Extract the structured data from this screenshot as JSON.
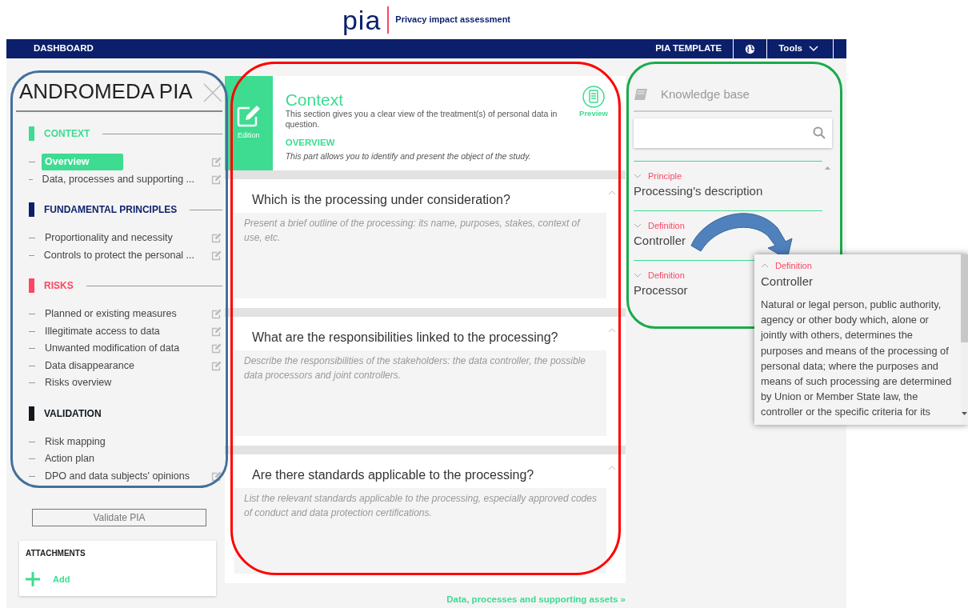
{
  "header": {
    "logo": "pia",
    "tagline": "Privacy impact assessment"
  },
  "navbar": {
    "left": "DASHBOARD",
    "template": "PIA TEMPLATE",
    "tools": "Tools"
  },
  "sidebar": {
    "title": "ANDROMEDA PIA",
    "sections": [
      {
        "title": "CONTEXT",
        "color": "#3ddc91",
        "items": [
          {
            "label": "Overview",
            "selected": true,
            "editable": true
          },
          {
            "label": "Data, processes and supporting ...",
            "selected": false,
            "editable": true
          }
        ]
      },
      {
        "title": "FUNDAMENTAL PRINCIPLES",
        "color": "#0b1f6b",
        "items": [
          {
            "label": "Proportionality and necessity",
            "selected": false,
            "editable": true
          },
          {
            "label": "Controls to protect the personal ...",
            "selected": false,
            "editable": true
          }
        ]
      },
      {
        "title": "RISKS",
        "color": "#fd4664",
        "items": [
          {
            "label": "Planned or existing measures",
            "selected": false,
            "editable": true
          },
          {
            "label": "Illegitimate access to data",
            "selected": false,
            "editable": true
          },
          {
            "label": "Unwanted modification of data",
            "selected": false,
            "editable": true
          },
          {
            "label": "Data disappearance",
            "selected": false,
            "editable": true
          },
          {
            "label": "Risks overview",
            "selected": false,
            "editable": false
          }
        ]
      },
      {
        "title": "VALIDATION",
        "color": "#111820",
        "items": [
          {
            "label": "Risk mapping",
            "selected": false,
            "editable": false
          },
          {
            "label": "Action plan",
            "selected": false,
            "editable": false
          },
          {
            "label": "DPO and data subjects' opinions",
            "selected": false,
            "editable": true
          }
        ]
      }
    ],
    "validate_button": "Validate PIA",
    "validate_disabled": true
  },
  "attachments": {
    "title": "ATTACHMENTS",
    "add": "Add"
  },
  "content": {
    "edition_label": "Edition",
    "title": "Context",
    "description": "This section gives you a clear view of the treatment(s) of personal data in question.",
    "subtitle": "OVERVIEW",
    "subdescription": "This part allows you to identify and present the object of the study.",
    "preview_label": "Preview",
    "questions": [
      {
        "question": "Which is the processing under consideration?",
        "placeholder": "Present a brief outline of the processing: its name, purposes, stakes, context of use, etc.",
        "expanded": true
      },
      {
        "question": "What are the responsibilities linked to the processing?",
        "placeholder": "Describe the responsibilities of the stakeholders: the data controller, the possible data processors and joint controllers.",
        "expanded": true
      },
      {
        "question": "Are there standards applicable to the processing?",
        "placeholder": "List the relevant standards applicable to the processing, especially approved codes of conduct and data protection certifications.",
        "expanded": true
      }
    ],
    "next_link": "Data, processes and supporting assets »"
  },
  "knowledge_base": {
    "title": "Knowledge base",
    "entries": [
      {
        "category": "Principle",
        "title": "Processing's description",
        "expanded": false
      },
      {
        "category": "Definition",
        "title": "Controller",
        "expanded": false
      },
      {
        "category": "Definition",
        "title": "Processor",
        "expanded": false
      }
    ],
    "popup": {
      "category": "Definition",
      "title": "Controller",
      "expanded": true,
      "body": "Natural or legal person, public authority, agency or other body which, alone or jointly with others, determines the purposes and means of the processing of personal data; where the purposes and means of such processing are determined by Union or Member State law, the controller or the specific criteria for its"
    }
  },
  "annotations": [
    {
      "kind": "outline",
      "color": "#44709c"
    },
    {
      "kind": "outline",
      "color": "#ff0000"
    },
    {
      "kind": "outline",
      "color": "#1aab4b"
    },
    {
      "kind": "arrow",
      "color": "#4f81bd"
    }
  ]
}
